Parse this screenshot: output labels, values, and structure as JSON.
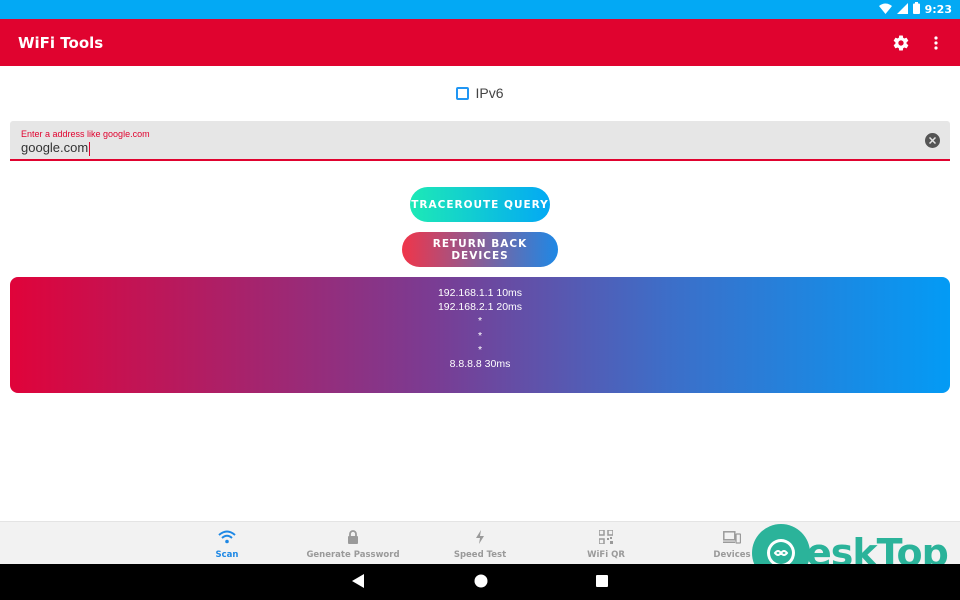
{
  "status_bar": {
    "time": "9:23",
    "wifi_icon": "wifi-icon",
    "signal_icon": "signal-icon",
    "battery_icon": "battery-icon"
  },
  "app_bar": {
    "title": "WiFi Tools",
    "settings_icon": "gear-icon",
    "more_icon": "more-vert-icon",
    "color": "#e0032f"
  },
  "ipv6": {
    "label": "IPv6",
    "checked": false
  },
  "address_input": {
    "hint": "Enter a address like google.com",
    "value": "google.com"
  },
  "buttons": {
    "traceroute": "TRACEROUTE QUERY",
    "return": "RETURN BACK DEVICES"
  },
  "results": [
    "192.168.1.1 10ms",
    "192.168.2.1 20ms",
    "*",
    "*",
    "*",
    "8.8.8.8 30ms"
  ],
  "bottom_nav": [
    {
      "label": "Scan",
      "icon": "wifi-icon",
      "active": true
    },
    {
      "label": "Generate Password",
      "icon": "lock-icon",
      "active": false
    },
    {
      "label": "Speed Test",
      "icon": "bolt-icon",
      "active": false
    },
    {
      "label": "WiFi QR",
      "icon": "qr-code-icon",
      "active": false
    },
    {
      "label": "Devices",
      "icon": "devices-icon",
      "active": false
    }
  ],
  "watermark": {
    "text": "eskTop"
  },
  "colors": {
    "accent_blue": "#03a9f4",
    "active_nav": "#1e88e5"
  }
}
